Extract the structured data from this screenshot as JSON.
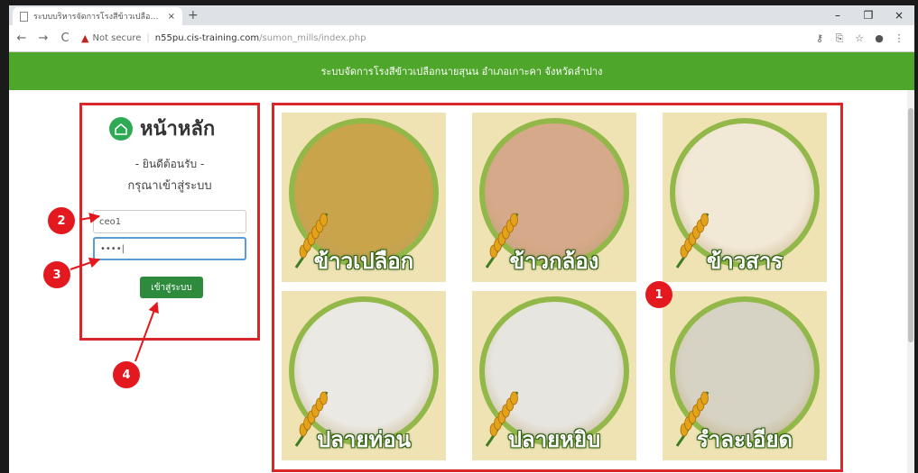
{
  "browser": {
    "tab_title": "ระบบบริหารจัดการโรงสีข้าวเปลือกนายสุนน",
    "tab_close": "×",
    "new_tab": "+",
    "window_controls": [
      "–",
      "❐",
      "×"
    ],
    "nav": {
      "back": "←",
      "forward": "→",
      "reload": "C"
    },
    "security_label": "Not secure",
    "url_host": "n55pu.cis-training.com",
    "url_path": "/sumon_mills/index.php",
    "right_icons": [
      "key-icon",
      "translate-icon",
      "star-icon",
      "account-icon",
      "menu-icon"
    ]
  },
  "banner": {
    "text": "ระบบจัดการโรงสีข้าวเปลือกนายสุนน อำเภอเกาะคา จังหวัดลำปาง"
  },
  "login": {
    "title": "หน้าหลัก",
    "welcome": "- ยินดีต้อนรับ -",
    "prompt": "กรุณาเข้าสู่ระบบ",
    "username_value": "ceo1",
    "password_value": "••••|",
    "submit_label": "เข้าสู่ระบบ"
  },
  "products": [
    {
      "label": "ข้าวเปลือก",
      "color": "#c9a44a"
    },
    {
      "label": "ข้าวกล้อง",
      "color": "#d6a98b"
    },
    {
      "label": "ข้าวสาร",
      "color": "#f1e8d6"
    },
    {
      "label": "ปลายท่อน",
      "color": "#ebe9e3"
    },
    {
      "label": "ปลายหยิบ",
      "color": "#e7e5df"
    },
    {
      "label": "รำละเอียด",
      "color": "#d7d3c4"
    }
  ],
  "callouts": [
    "1",
    "2",
    "3",
    "4"
  ],
  "colors": {
    "banner": "#4ea72a",
    "highlight": "#d8262b",
    "callout": "#e3191f",
    "button": "#2e8b3e"
  }
}
